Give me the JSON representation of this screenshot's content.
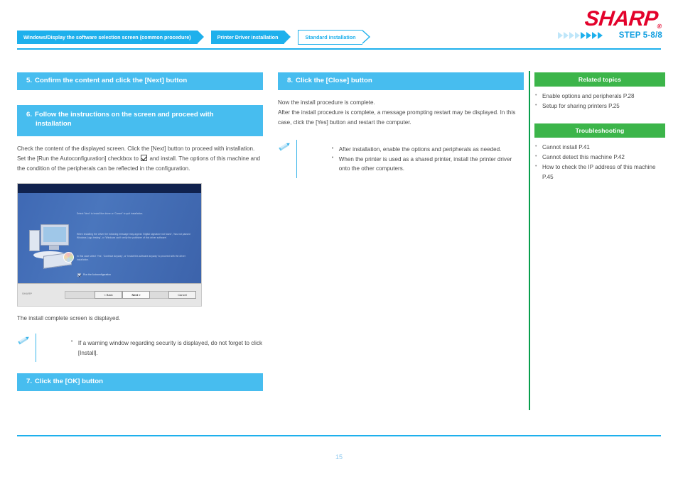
{
  "header": {
    "logo_text": "SHARP",
    "logo_color": "#e3022b",
    "breadcrumbs": [
      {
        "label": "Windows/Display the software selection screen (common procedure)",
        "style": "filled"
      },
      {
        "label": "Printer Driver installation",
        "style": "filled"
      },
      {
        "label": "Standard installation",
        "style": "outlined"
      }
    ],
    "step_label": "STEP  5-8/8",
    "step_markers": {
      "hollow": 4,
      "filled": 4
    },
    "accent_color": "#1eb0ec"
  },
  "left_column": {
    "step5": {
      "number": "5.",
      "title": "Confirm the content and click the [Next] button"
    },
    "step6": {
      "number": "6.",
      "title_line1": "Follow the instructions on the screen and proceed with",
      "title_line2": "installation"
    },
    "body_part1": "Check the content of the displayed screen. Click the [Next] button to proceed with installation. Set the [Run the Autoconfiguration] checkbox to ",
    "body_part2": " and install. The options of this machine and the condition of the peripherals can be reflected in the configuration.",
    "screenshot": {
      "paragraph1": "Select 'Next' to install the driver or 'Cancel' to quit installation.",
      "paragraph2": "When installing the driver the following message may appear 'Digital signature not found', 'has not passed Windows Logo testing', or 'Windows can't verify the publisher of this driver software'.",
      "paragraph3": "In this case select 'Yes', 'Continue Anyway', or 'Install this software anyway' to proceed with the driver installation.",
      "checkbox_label": "Run the Autoconfiguration",
      "brand": "SHARP",
      "button_back": "< Back",
      "button_next": "Next >",
      "button_cancel": "Cancel"
    },
    "caption": "The install complete screen is displayed.",
    "note_items": [
      "If a warning window regarding security is displayed, do not forget to click [Install]."
    ],
    "step7": {
      "number": "7.",
      "title": "Click the [OK] button"
    }
  },
  "mid_column": {
    "step8": {
      "number": "8.",
      "title": "Click the [Close] button"
    },
    "body_line1": "Now the install procedure is complete.",
    "body_line2": "After the install procedure is complete, a message prompting restart may be displayed. In this case, click the [Yes] button and restart the computer.",
    "note_items": [
      "After installation, enable the options and peripherals as needed.",
      "When the printer is used as a shared printer, install the printer driver onto the other computers."
    ]
  },
  "right_column": {
    "related": {
      "title": "Related topics",
      "items": [
        "Enable options and peripherals P.28",
        "Setup for sharing printers P.25"
      ]
    },
    "troubleshooting": {
      "title": "Troubleshooting",
      "items": [
        "Cannot install P.41",
        "Cannot detect this machine P.42",
        "How to check the IP address of this machine P.45"
      ]
    },
    "panel_color": "#3cb54a"
  },
  "footer": {
    "page_number": "15"
  }
}
